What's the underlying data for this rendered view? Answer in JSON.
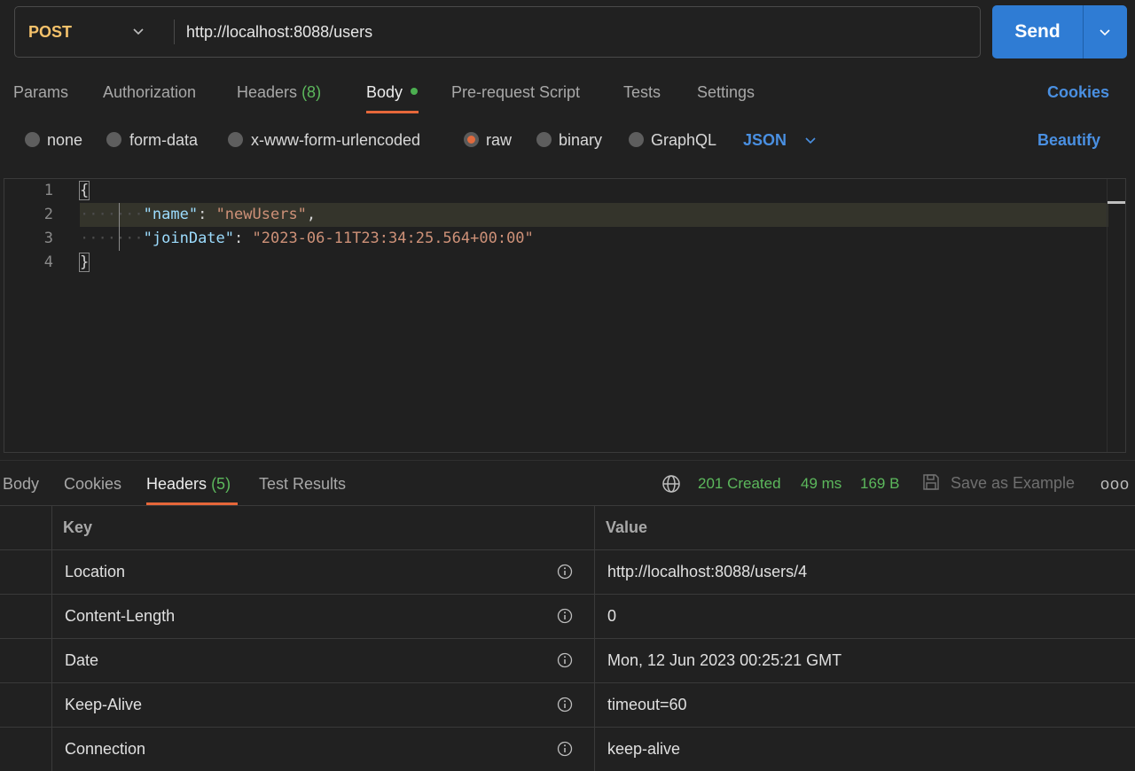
{
  "request": {
    "method": "POST",
    "url": "http://localhost:8088/users",
    "send_label": "Send"
  },
  "request_tabs": {
    "params": "Params",
    "authorization": "Authorization",
    "headers": "Headers",
    "headers_count": "(8)",
    "body": "Body",
    "prerequest": "Pre-request Script",
    "tests": "Tests",
    "settings": "Settings",
    "cookies": "Cookies"
  },
  "body_types": {
    "none": "none",
    "form_data": "form-data",
    "urlencoded": "x-www-form-urlencoded",
    "raw": "raw",
    "binary": "binary",
    "graphql": "GraphQL",
    "selected": "raw",
    "format": "JSON",
    "beautify": "Beautify"
  },
  "editor": {
    "line_numbers": [
      "1",
      "2",
      "3",
      "4"
    ],
    "open_brace": "{",
    "close_brace": "}",
    "key1": "\"name\"",
    "val1": "\"newUsers\"",
    "key2": "\"joinDate\"",
    "val2": "\"2023-06-11T23:34:25.564+00:00\""
  },
  "response_tabs": {
    "body": "Body",
    "cookies": "Cookies",
    "headers": "Headers",
    "headers_count": "(5)",
    "test_results": "Test Results"
  },
  "response_status": {
    "status": "201 Created",
    "time": "49 ms",
    "size": "169 B",
    "save_example": "Save as Example",
    "more": "ooo"
  },
  "headers_table": {
    "key_header": "Key",
    "value_header": "Value",
    "rows": [
      {
        "key": "Location",
        "value": "http://localhost:8088/users/4"
      },
      {
        "key": "Content-Length",
        "value": "0"
      },
      {
        "key": "Date",
        "value": "Mon, 12 Jun 2023 00:25:21 GMT"
      },
      {
        "key": "Keep-Alive",
        "value": "timeout=60"
      },
      {
        "key": "Connection",
        "value": "keep-alive"
      }
    ]
  },
  "colors": {
    "accent": "#2f7cd4",
    "tab_underline": "#e6673a",
    "method": "#f5c26b",
    "link": "#4a90e2",
    "success": "#5cb85c"
  }
}
